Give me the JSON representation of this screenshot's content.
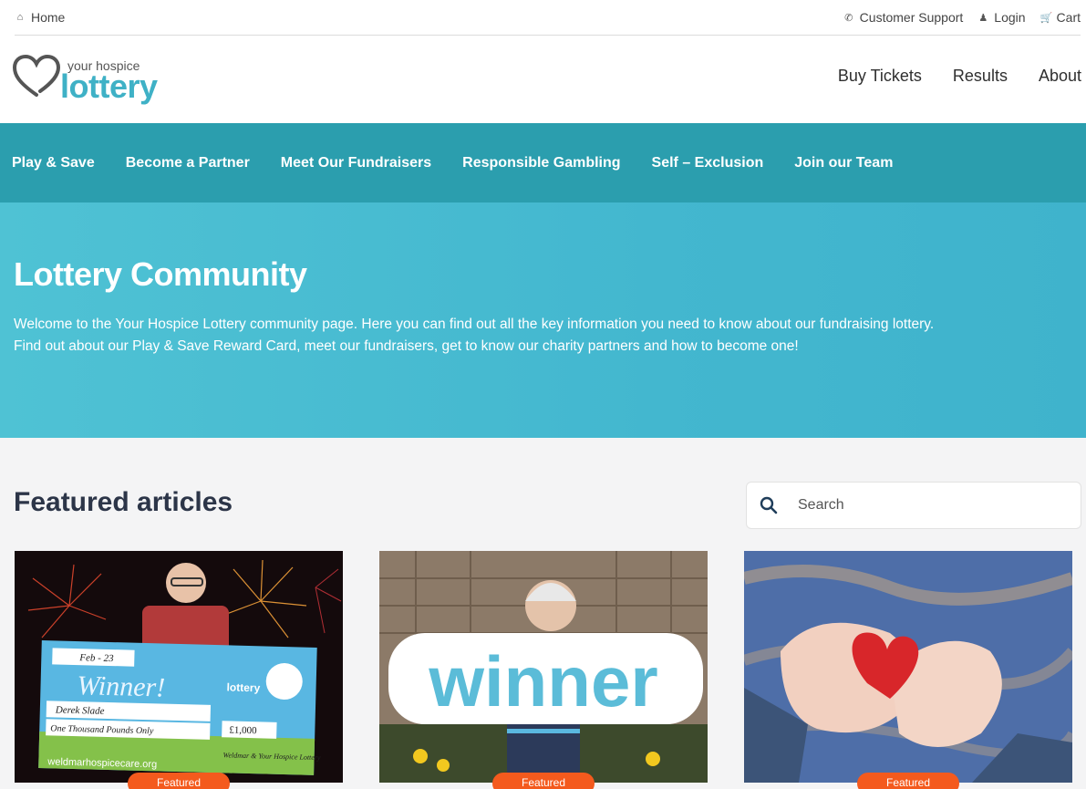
{
  "topbar": {
    "home": "Home",
    "support": "Customer Support",
    "login": "Login",
    "cart": "Cart"
  },
  "logo": {
    "small": "your hospice",
    "big": "lottery"
  },
  "mainnav": [
    "Buy Tickets",
    "Results",
    "About"
  ],
  "subnav": [
    "Play & Save",
    "Become a Partner",
    "Meet Our Fundraisers",
    "Responsible Gambling",
    "Self – Exclusion",
    "Join our Team"
  ],
  "hero": {
    "title": "Lottery Community",
    "line1": "Welcome to the Your Hospice Lottery community page. Here you can find out all the key information you need to know about our fundraising lottery.",
    "line2": "Find out about our Play & Save Reward Card, meet our fundraisers, get to know our charity partners and how to become one!"
  },
  "featured": {
    "title": "Featured articles",
    "search_placeholder": "Search",
    "badge": "Featured",
    "card1": {
      "cheque_date": "Feb - 23",
      "cheque_title": "Winner!",
      "cheque_name": "Derek Slade",
      "cheque_words": "One Thousand Pounds Only",
      "cheque_amount": "£1,000",
      "cheque_signed": "Weldmar & Your Hospice Lottery",
      "cheque_url": "weldmarhospicecare.org",
      "cheque_logo": "lottery"
    },
    "card2": {
      "sign": "winner"
    }
  },
  "colors": {
    "teal_dark": "#2b9eae",
    "teal_light": "#4fc2d4",
    "logo": "#3fb1c6",
    "badge": "#f45a1d"
  }
}
